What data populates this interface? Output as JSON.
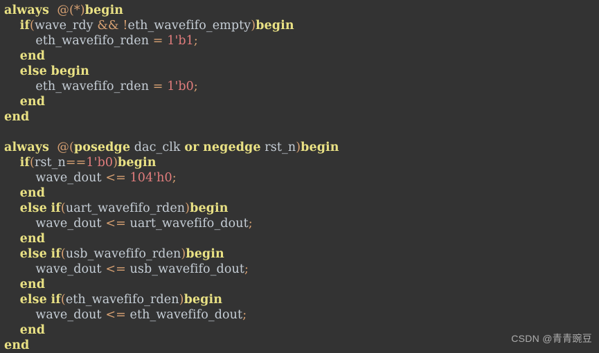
{
  "editor": {
    "background_color": "#333333",
    "language": "verilog",
    "font_size_px": 17.5,
    "line_height_px": 22,
    "total_lines": 22
  },
  "theme": {
    "keyword_color": "#e9e184",
    "identifier_color": "#c6ced6",
    "operator_color": "#d9a273",
    "number_color": "#e27d7d",
    "background_color": "#333333",
    "watermark_color": "#b9b9b9"
  },
  "code": {
    "lines": [
      {
        "index": 1,
        "indent": 0,
        "text": "always  @(*)begin",
        "tokens": [
          {
            "t": "always",
            "k": "kw"
          },
          {
            "t": "  ",
            "k": "plain"
          },
          {
            "t": "@(*)",
            "k": "op"
          },
          {
            "t": "begin",
            "k": "kw"
          }
        ]
      },
      {
        "index": 2,
        "indent": 4,
        "text": "    if(wave_rdy && !eth_wavefifo_empty)begin",
        "tokens": [
          {
            "t": "    ",
            "k": "plain"
          },
          {
            "t": "if",
            "k": "kw"
          },
          {
            "t": "(",
            "k": "op"
          },
          {
            "t": "wave_rdy",
            "k": "id"
          },
          {
            "t": " ",
            "k": "plain"
          },
          {
            "t": "&&",
            "k": "op"
          },
          {
            "t": " ",
            "k": "plain"
          },
          {
            "t": "!",
            "k": "op"
          },
          {
            "t": "eth_wavefifo_empty",
            "k": "id"
          },
          {
            "t": ")",
            "k": "op"
          },
          {
            "t": "begin",
            "k": "kw"
          }
        ]
      },
      {
        "index": 3,
        "indent": 8,
        "text": "        eth_wavefifo_rden = 1'b1;",
        "tokens": [
          {
            "t": "        ",
            "k": "plain"
          },
          {
            "t": "eth_wavefifo_rden",
            "k": "id"
          },
          {
            "t": " ",
            "k": "plain"
          },
          {
            "t": "=",
            "k": "op"
          },
          {
            "t": " ",
            "k": "plain"
          },
          {
            "t": "1'b1",
            "k": "num"
          },
          {
            "t": ";",
            "k": "op"
          }
        ]
      },
      {
        "index": 4,
        "indent": 4,
        "text": "    end",
        "tokens": [
          {
            "t": "    ",
            "k": "plain"
          },
          {
            "t": "end",
            "k": "kw"
          }
        ]
      },
      {
        "index": 5,
        "indent": 4,
        "text": "    else begin",
        "tokens": [
          {
            "t": "    ",
            "k": "plain"
          },
          {
            "t": "else",
            "k": "kw"
          },
          {
            "t": " ",
            "k": "plain"
          },
          {
            "t": "begin",
            "k": "kw"
          }
        ]
      },
      {
        "index": 6,
        "indent": 8,
        "text": "        eth_wavefifo_rden = 1'b0;",
        "tokens": [
          {
            "t": "        ",
            "k": "plain"
          },
          {
            "t": "eth_wavefifo_rden",
            "k": "id"
          },
          {
            "t": " ",
            "k": "plain"
          },
          {
            "t": "=",
            "k": "op"
          },
          {
            "t": " ",
            "k": "plain"
          },
          {
            "t": "1'b0",
            "k": "num"
          },
          {
            "t": ";",
            "k": "op"
          }
        ]
      },
      {
        "index": 7,
        "indent": 4,
        "text": "    end",
        "tokens": [
          {
            "t": "    ",
            "k": "plain"
          },
          {
            "t": "end",
            "k": "kw"
          }
        ]
      },
      {
        "index": 8,
        "indent": 0,
        "text": "end",
        "tokens": [
          {
            "t": "end",
            "k": "kw"
          }
        ]
      },
      {
        "index": 9,
        "indent": 0,
        "text": "",
        "tokens": []
      },
      {
        "index": 10,
        "indent": 0,
        "text": "always  @(posedge dac_clk or negedge rst_n)begin",
        "tokens": [
          {
            "t": "always",
            "k": "kw"
          },
          {
            "t": "  ",
            "k": "plain"
          },
          {
            "t": "@(",
            "k": "op"
          },
          {
            "t": "posedge",
            "k": "kw"
          },
          {
            "t": " ",
            "k": "plain"
          },
          {
            "t": "dac_clk",
            "k": "id"
          },
          {
            "t": " ",
            "k": "plain"
          },
          {
            "t": "or",
            "k": "kw"
          },
          {
            "t": " ",
            "k": "plain"
          },
          {
            "t": "negedge",
            "k": "kw"
          },
          {
            "t": " ",
            "k": "plain"
          },
          {
            "t": "rst_n",
            "k": "id"
          },
          {
            "t": ")",
            "k": "op"
          },
          {
            "t": "begin",
            "k": "kw"
          }
        ]
      },
      {
        "index": 11,
        "indent": 4,
        "text": "    if(rst_n==1'b0)begin",
        "tokens": [
          {
            "t": "    ",
            "k": "plain"
          },
          {
            "t": "if",
            "k": "kw"
          },
          {
            "t": "(",
            "k": "op"
          },
          {
            "t": "rst_n",
            "k": "id"
          },
          {
            "t": "==",
            "k": "op"
          },
          {
            "t": "1'b0",
            "k": "num"
          },
          {
            "t": ")",
            "k": "op"
          },
          {
            "t": "begin",
            "k": "kw"
          }
        ]
      },
      {
        "index": 12,
        "indent": 8,
        "text": "        wave_dout <= 104'h0;",
        "tokens": [
          {
            "t": "        ",
            "k": "plain"
          },
          {
            "t": "wave_dout",
            "k": "id"
          },
          {
            "t": " ",
            "k": "plain"
          },
          {
            "t": "<=",
            "k": "op"
          },
          {
            "t": " ",
            "k": "plain"
          },
          {
            "t": "104'h0",
            "k": "num"
          },
          {
            "t": ";",
            "k": "op"
          }
        ]
      },
      {
        "index": 13,
        "indent": 4,
        "text": "    end",
        "tokens": [
          {
            "t": "    ",
            "k": "plain"
          },
          {
            "t": "end",
            "k": "kw"
          }
        ]
      },
      {
        "index": 14,
        "indent": 4,
        "text": "    else if(uart_wavefifo_rden)begin",
        "tokens": [
          {
            "t": "    ",
            "k": "plain"
          },
          {
            "t": "else",
            "k": "kw"
          },
          {
            "t": " ",
            "k": "plain"
          },
          {
            "t": "if",
            "k": "kw"
          },
          {
            "t": "(",
            "k": "op"
          },
          {
            "t": "uart_wavefifo_rden",
            "k": "id"
          },
          {
            "t": ")",
            "k": "op"
          },
          {
            "t": "begin",
            "k": "kw"
          }
        ]
      },
      {
        "index": 15,
        "indent": 8,
        "text": "        wave_dout <= uart_wavefifo_dout;",
        "tokens": [
          {
            "t": "        ",
            "k": "plain"
          },
          {
            "t": "wave_dout",
            "k": "id"
          },
          {
            "t": " ",
            "k": "plain"
          },
          {
            "t": "<=",
            "k": "op"
          },
          {
            "t": " ",
            "k": "plain"
          },
          {
            "t": "uart_wavefifo_dout",
            "k": "id"
          },
          {
            "t": ";",
            "k": "op"
          }
        ]
      },
      {
        "index": 16,
        "indent": 4,
        "text": "    end",
        "tokens": [
          {
            "t": "    ",
            "k": "plain"
          },
          {
            "t": "end",
            "k": "kw"
          }
        ]
      },
      {
        "index": 17,
        "indent": 4,
        "text": "    else if(usb_wavefifo_rden)begin",
        "tokens": [
          {
            "t": "    ",
            "k": "plain"
          },
          {
            "t": "else",
            "k": "kw"
          },
          {
            "t": " ",
            "k": "plain"
          },
          {
            "t": "if",
            "k": "kw"
          },
          {
            "t": "(",
            "k": "op"
          },
          {
            "t": "usb_wavefifo_rden",
            "k": "id"
          },
          {
            "t": ")",
            "k": "op"
          },
          {
            "t": "begin",
            "k": "kw"
          }
        ]
      },
      {
        "index": 18,
        "indent": 8,
        "text": "        wave_dout <= usb_wavefifo_dout;",
        "tokens": [
          {
            "t": "        ",
            "k": "plain"
          },
          {
            "t": "wave_dout",
            "k": "id"
          },
          {
            "t": " ",
            "k": "plain"
          },
          {
            "t": "<=",
            "k": "op"
          },
          {
            "t": " ",
            "k": "plain"
          },
          {
            "t": "usb_wavefifo_dout",
            "k": "id"
          },
          {
            "t": ";",
            "k": "op"
          }
        ]
      },
      {
        "index": 19,
        "indent": 4,
        "text": "    end",
        "tokens": [
          {
            "t": "    ",
            "k": "plain"
          },
          {
            "t": "end",
            "k": "kw"
          }
        ]
      },
      {
        "index": 20,
        "indent": 4,
        "text": "    else if(eth_wavefifo_rden)begin",
        "tokens": [
          {
            "t": "    ",
            "k": "plain"
          },
          {
            "t": "else",
            "k": "kw"
          },
          {
            "t": " ",
            "k": "plain"
          },
          {
            "t": "if",
            "k": "kw"
          },
          {
            "t": "(",
            "k": "op"
          },
          {
            "t": "eth_wavefifo_rden",
            "k": "id"
          },
          {
            "t": ")",
            "k": "op"
          },
          {
            "t": "begin",
            "k": "kw"
          }
        ]
      },
      {
        "index": 21,
        "indent": 8,
        "text": "        wave_dout <= eth_wavefifo_dout;",
        "tokens": [
          {
            "t": "        ",
            "k": "plain"
          },
          {
            "t": "wave_dout",
            "k": "id"
          },
          {
            "t": " ",
            "k": "plain"
          },
          {
            "t": "<=",
            "k": "op"
          },
          {
            "t": " ",
            "k": "plain"
          },
          {
            "t": "eth_wavefifo_dout",
            "k": "id"
          },
          {
            "t": ";",
            "k": "op"
          }
        ]
      },
      {
        "index": 22,
        "indent": 4,
        "text": "    end",
        "tokens": [
          {
            "t": "    ",
            "k": "plain"
          },
          {
            "t": "end",
            "k": "kw"
          }
        ]
      },
      {
        "index": 23,
        "indent": 0,
        "text": "end",
        "tokens": [
          {
            "t": "end",
            "k": "kw"
          }
        ]
      }
    ]
  },
  "watermark": {
    "text": "CSDN @青青豌豆",
    "prefix": "CSDN",
    "handle": "@青青豌豆"
  }
}
